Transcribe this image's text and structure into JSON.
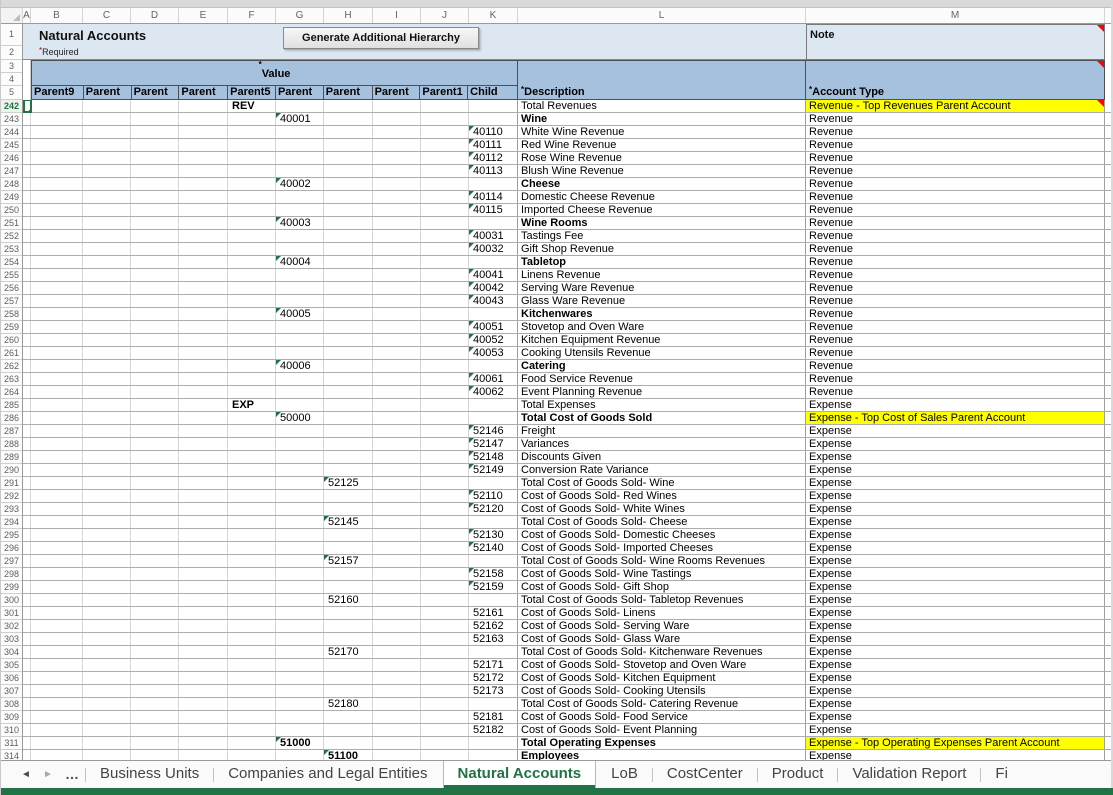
{
  "title_area": {
    "title": "Natural Accounts",
    "required": {
      "marker": "*",
      "text": "Required"
    },
    "button_label": "Generate Additional Hierarchy",
    "note_label": "Note"
  },
  "headers": {
    "value": {
      "marker": "*",
      "text": "Value"
    },
    "description": {
      "marker": "*",
      "text": "Description"
    },
    "account_type": {
      "marker": "*",
      "text": "Account Type"
    },
    "parent_columns": [
      "Parent9",
      "Parent",
      "Parent",
      "Parent",
      "Parent5",
      "Parent",
      "Parent",
      "Parent",
      "Parent1",
      "Child"
    ]
  },
  "sheet": {
    "column_letters": [
      "A",
      "B",
      "C",
      "D",
      "E",
      "F",
      "G",
      "H",
      "I",
      "J",
      "K",
      "L",
      "M"
    ],
    "header_row_numbers": [
      "1",
      "2",
      "3",
      "4",
      "5"
    ],
    "rows": [
      {
        "n": "242",
        "col": "F",
        "val": "REV",
        "vbold": true,
        "desc": "Total Revenues",
        "type": "Revenue - Top Revenues Parent Account",
        "hl": true,
        "rtri": true,
        "sel": true
      },
      {
        "n": "243",
        "col": "G",
        "val": "40001",
        "tri": true,
        "desc": "Wine",
        "dbold": true,
        "type": "Revenue"
      },
      {
        "n": "244",
        "col": "K",
        "val": "40110",
        "tri": true,
        "desc": "White Wine Revenue",
        "type": "Revenue"
      },
      {
        "n": "245",
        "col": "K",
        "val": "40111",
        "tri": true,
        "desc": "Red Wine Revenue",
        "type": "Revenue"
      },
      {
        "n": "246",
        "col": "K",
        "val": "40112",
        "tri": true,
        "desc": "Rose Wine Revenue",
        "type": "Revenue"
      },
      {
        "n": "247",
        "col": "K",
        "val": "40113",
        "tri": true,
        "desc": "Blush Wine Revenue",
        "type": "Revenue"
      },
      {
        "n": "248",
        "col": "G",
        "val": "40002",
        "tri": true,
        "desc": "Cheese",
        "dbold": true,
        "type": "Revenue"
      },
      {
        "n": "249",
        "col": "K",
        "val": "40114",
        "tri": true,
        "desc": "Domestic Cheese Revenue",
        "type": "Revenue"
      },
      {
        "n": "250",
        "col": "K",
        "val": "40115",
        "tri": true,
        "desc": "Imported Cheese Revenue",
        "type": "Revenue"
      },
      {
        "n": "251",
        "col": "G",
        "val": "40003",
        "tri": true,
        "desc": "Wine Rooms",
        "dbold": true,
        "type": "Revenue"
      },
      {
        "n": "252",
        "col": "K",
        "val": "40031",
        "tri": true,
        "desc": "Tastings Fee",
        "type": "Revenue"
      },
      {
        "n": "253",
        "col": "K",
        "val": "40032",
        "tri": true,
        "desc": "Gift Shop Revenue",
        "type": "Revenue"
      },
      {
        "n": "254",
        "col": "G",
        "val": "40004",
        "tri": true,
        "desc": "Tabletop",
        "dbold": true,
        "type": "Revenue"
      },
      {
        "n": "255",
        "col": "K",
        "val": "40041",
        "tri": true,
        "desc": "Linens Revenue",
        "type": "Revenue"
      },
      {
        "n": "256",
        "col": "K",
        "val": "40042",
        "tri": true,
        "desc": "Serving Ware Revenue",
        "type": "Revenue"
      },
      {
        "n": "257",
        "col": "K",
        "val": "40043",
        "tri": true,
        "desc": "Glass Ware Revenue",
        "type": "Revenue"
      },
      {
        "n": "258",
        "col": "G",
        "val": "40005",
        "tri": true,
        "desc": "Kitchenwares",
        "dbold": true,
        "type": "Revenue"
      },
      {
        "n": "259",
        "col": "K",
        "val": "40051",
        "tri": true,
        "desc": "Stovetop and Oven Ware",
        "type": "Revenue"
      },
      {
        "n": "260",
        "col": "K",
        "val": "40052",
        "tri": true,
        "desc": "Kitchen Equipment Revenue",
        "type": "Revenue"
      },
      {
        "n": "261",
        "col": "K",
        "val": "40053",
        "tri": true,
        "desc": "Cooking Utensils Revenue",
        "type": "Revenue"
      },
      {
        "n": "262",
        "col": "G",
        "val": "40006",
        "tri": true,
        "desc": "Catering",
        "dbold": true,
        "type": "Revenue"
      },
      {
        "n": "263",
        "col": "K",
        "val": "40061",
        "tri": true,
        "desc": "Food Service Revenue",
        "type": "Revenue"
      },
      {
        "n": "264",
        "col": "K",
        "val": "40062",
        "tri": true,
        "desc": "Event Planning Revenue",
        "type": "Revenue"
      },
      {
        "n": "285",
        "col": "F",
        "val": "EXP",
        "vbold": true,
        "desc": "Total Expenses",
        "type": "Expense"
      },
      {
        "n": "286",
        "col": "G",
        "val": "50000",
        "tri": true,
        "desc": "Total Cost of Goods Sold",
        "dbold": true,
        "type": "Expense - Top Cost of Sales Parent Account",
        "hl": true
      },
      {
        "n": "287",
        "col": "K",
        "val": "52146",
        "tri": true,
        "desc": "Freight",
        "type": "Expense"
      },
      {
        "n": "288",
        "col": "K",
        "val": "52147",
        "tri": true,
        "desc": "Variances",
        "type": "Expense"
      },
      {
        "n": "289",
        "col": "K",
        "val": "52148",
        "tri": true,
        "desc": "Discounts Given",
        "type": "Expense"
      },
      {
        "n": "290",
        "col": "K",
        "val": "52149",
        "tri": true,
        "desc": "Conversion Rate Variance",
        "type": "Expense"
      },
      {
        "n": "291",
        "col": "H",
        "val": "52125",
        "tri": true,
        "desc": "Total Cost of Goods Sold- Wine",
        "type": "Expense"
      },
      {
        "n": "292",
        "col": "K",
        "val": "52110",
        "tri": true,
        "desc": "Cost of Goods Sold- Red Wines",
        "type": "Expense"
      },
      {
        "n": "293",
        "col": "K",
        "val": "52120",
        "tri": true,
        "desc": "Cost of Goods Sold- White Wines",
        "type": "Expense"
      },
      {
        "n": "294",
        "col": "H",
        "val": "52145",
        "tri": true,
        "desc": "Total Cost of Goods Sold- Cheese",
        "type": "Expense"
      },
      {
        "n": "295",
        "col": "K",
        "val": "52130",
        "tri": true,
        "desc": "Cost of Goods Sold- Domestic Cheeses",
        "type": "Expense"
      },
      {
        "n": "296",
        "col": "K",
        "val": "52140",
        "tri": true,
        "desc": "Cost of Goods Sold- Imported Cheeses",
        "type": "Expense"
      },
      {
        "n": "297",
        "col": "H",
        "val": "52157",
        "tri": true,
        "desc": "Total Cost of Goods Sold- Wine Rooms Revenues",
        "type": "Expense"
      },
      {
        "n": "298",
        "col": "K",
        "val": "52158",
        "tri": true,
        "desc": "Cost of Goods Sold- Wine Tastings",
        "type": "Expense"
      },
      {
        "n": "299",
        "col": "K",
        "val": "52159",
        "tri": true,
        "desc": "Cost of Goods Sold- Gift Shop",
        "type": "Expense"
      },
      {
        "n": "300",
        "col": "H",
        "val": "52160",
        "desc": "Total Cost of Goods Sold- Tabletop Revenues",
        "type": "Expense"
      },
      {
        "n": "301",
        "col": "K",
        "val": "52161",
        "desc": "Cost of Goods Sold- Linens",
        "type": "Expense"
      },
      {
        "n": "302",
        "col": "K",
        "val": "52162",
        "desc": "Cost of Goods Sold- Serving Ware",
        "type": "Expense"
      },
      {
        "n": "303",
        "col": "K",
        "val": "52163",
        "desc": "Cost of Goods Sold- Glass Ware",
        "type": "Expense"
      },
      {
        "n": "304",
        "col": "H",
        "val": "52170",
        "desc": "Total Cost of Goods Sold- Kitchenware Revenues",
        "type": "Expense"
      },
      {
        "n": "305",
        "col": "K",
        "val": "52171",
        "desc": "Cost of Goods Sold- Stovetop and Oven Ware",
        "type": "Expense"
      },
      {
        "n": "306",
        "col": "K",
        "val": "52172",
        "desc": "Cost of Goods Sold- Kitchen Equipment",
        "type": "Expense"
      },
      {
        "n": "307",
        "col": "K",
        "val": "52173",
        "desc": "Cost of Goods Sold- Cooking Utensils",
        "type": "Expense"
      },
      {
        "n": "308",
        "col": "H",
        "val": "52180",
        "desc": "Total Cost of Goods Sold- Catering Revenue",
        "type": "Expense"
      },
      {
        "n": "309",
        "col": "K",
        "val": "52181",
        "desc": "Cost of Goods Sold- Food Service",
        "type": "Expense"
      },
      {
        "n": "310",
        "col": "K",
        "val": "52182",
        "desc": "Cost of Goods Sold- Event Planning",
        "type": "Expense"
      },
      {
        "n": "311",
        "col": "G",
        "val": "51000",
        "tri": true,
        "vbold": true,
        "desc": "Total Operating Expenses",
        "dbold": true,
        "type": "Expense - Top Operating Expenses Parent Account",
        "hl": true
      },
      {
        "n": "314",
        "col": "H",
        "val": "51100",
        "tri": true,
        "vbold": true,
        "desc": "Employees",
        "dbold": true,
        "type": "Expense"
      }
    ]
  },
  "tabs": {
    "nav_left": "◄",
    "nav_right": "►",
    "nav_more": "…",
    "items": [
      {
        "label": "Business Units",
        "active": false
      },
      {
        "label": "Companies and Legal Entities",
        "active": false
      },
      {
        "label": "Natural Accounts",
        "active": true
      },
      {
        "label": "LoB",
        "active": false
      },
      {
        "label": "CostCenter",
        "active": false
      },
      {
        "label": "Product",
        "active": false
      },
      {
        "label": "Validation Report",
        "active": false
      },
      {
        "label": "Fi",
        "active": false
      }
    ]
  },
  "colors": {
    "accent_green": "#217346",
    "triangle_green": "#1e7145",
    "highlight_yellow": "#ffff00",
    "warning_red": "#ff0000",
    "header_blue": "#a6c1de",
    "band_blue": "#dce7f2"
  }
}
